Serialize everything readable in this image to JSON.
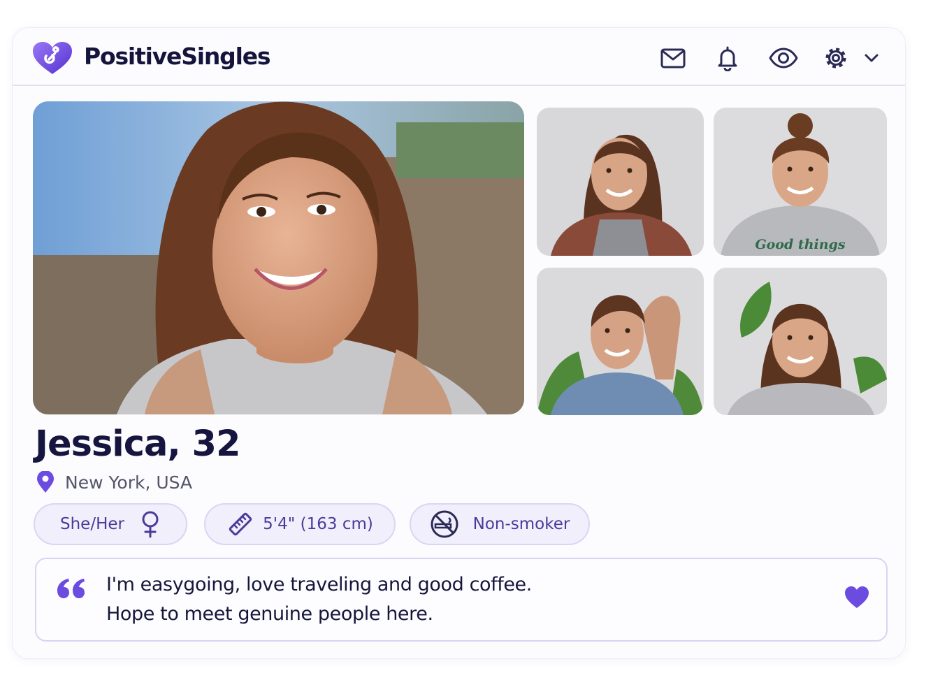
{
  "app": {
    "brand_name": "PositiveSingles",
    "colors": {
      "accent": "#5b3fd6",
      "accent_light": "#8b6cf0",
      "text_dark": "#15153f",
      "pill_bg": "#f1effc",
      "pill_border": "#d9d5f5"
    }
  },
  "header": {
    "icons": [
      "mail-icon",
      "bell-icon",
      "eye-icon",
      "gear-icon",
      "chevron-down-icon"
    ]
  },
  "photos": {
    "main": {
      "subject": "portrait-smiling-woman-outdoors"
    },
    "thumbnails": [
      {
        "subject": "floral-shirt-portrait"
      },
      {
        "subject": "grey-hoodie-portrait",
        "shirt_text": "Good things"
      },
      {
        "subject": "denim-shirt-portrait"
      },
      {
        "subject": "plant-background-portrait"
      }
    ]
  },
  "profile": {
    "name_age": "Jessica, 32",
    "location": "New York, USA",
    "tags": [
      {
        "label": "She/Her",
        "icon": "female-symbol-icon"
      },
      {
        "label": "5'4\" (163 cm)",
        "icon": "ruler-icon"
      },
      {
        "label": "Non-smoker",
        "icon": "no-smoking-icon"
      }
    ],
    "bio_lines": [
      "I'm easygoing, love traveling and good coffee.",
      "Hope to meet genuine people here."
    ]
  }
}
